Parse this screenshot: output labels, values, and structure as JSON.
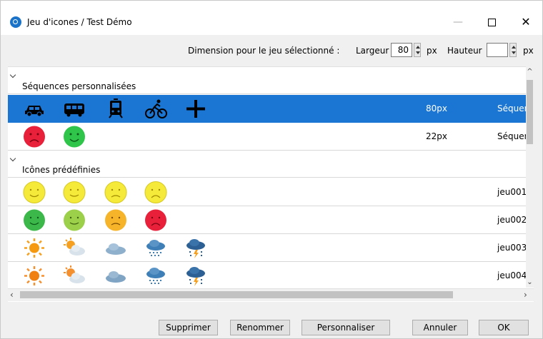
{
  "window": {
    "title": "Jeu d'icones / Test Démo",
    "controls": {
      "minimize": "—",
      "close": "✕"
    }
  },
  "dimension": {
    "label": "Dimension pour le jeu sélectionné :",
    "largeur_label": "Largeur",
    "largeur_value": "80",
    "px1": "px",
    "hauteur_label": "Hauteur",
    "hauteur_value": "",
    "px2": "px"
  },
  "groups": {
    "custom": {
      "title": "Séquences personnalisées",
      "rows": [
        {
          "icons": [
            "car-icon",
            "bus-icon",
            "tram-icon",
            "bicycle-icon",
            "plus-icon"
          ],
          "size": "80px",
          "name": "Séquence",
          "selected": true
        },
        {
          "icons": [
            "sad-face-red-icon",
            "smile-face-green-icon"
          ],
          "size": "22px",
          "name": "Séquence",
          "selected": false
        }
      ]
    },
    "predefined": {
      "title": "Icônes prédéfinies",
      "rows": [
        {
          "icons": [
            "smile-yellow-icon",
            "smile-yellow-icon",
            "sad-yellow-icon",
            "sad-yellow-icon"
          ],
          "size": "",
          "name": "jeu001"
        },
        {
          "icons": [
            "smile-green-icon",
            "smile-lightgreen-icon",
            "sad-orange-icon",
            "sad-red-icon"
          ],
          "size": "",
          "name": "jeu002"
        },
        {
          "icons": [
            "sun-icon",
            "sun-cloud-icon",
            "cloud-icon",
            "rain-cloud-icon",
            "storm-cloud-icon"
          ],
          "size": "",
          "name": "jeu003"
        },
        {
          "icons": [
            "sun-icon",
            "sun-cloud-icon",
            "cloud-icon",
            "rain-cloud-icon",
            "storm-cloud-icon"
          ],
          "size": "",
          "name": "jeu004"
        }
      ]
    }
  },
  "buttons": {
    "supprimer": "Supprimer",
    "renommer": "Renommer",
    "personnaliser": "Personnaliser",
    "annuler": "Annuler",
    "ok": "OK"
  },
  "colors": {
    "selection": "#1a76d2",
    "accent": "#1a73c8"
  }
}
